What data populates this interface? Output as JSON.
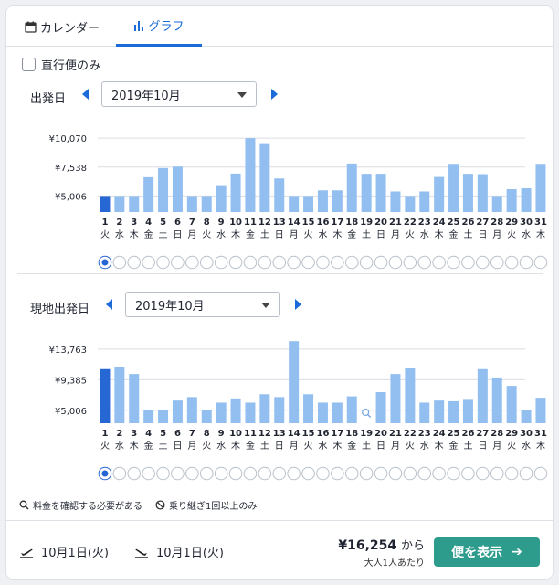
{
  "tabs": [
    {
      "label": "カレンダー",
      "icon": "calendar-icon",
      "active": false
    },
    {
      "label": "グラフ",
      "icon": "bar-chart-icon",
      "active": true
    }
  ],
  "direct_only_label": "直行便のみ",
  "departure": {
    "label": "出発日",
    "month_select": "2019年10月"
  },
  "return": {
    "label": "現地出発日",
    "month_select": "2019年10月"
  },
  "chart_data": [
    {
      "type": "bar",
      "name": "出発日",
      "categories": [
        "1",
        "2",
        "3",
        "4",
        "5",
        "6",
        "7",
        "8",
        "9",
        "10",
        "11",
        "12",
        "13",
        "14",
        "15",
        "16",
        "17",
        "18",
        "19",
        "20",
        "21",
        "22",
        "23",
        "24",
        "25",
        "26",
        "27",
        "28",
        "29",
        "30",
        "31"
      ],
      "weekdays": [
        "火",
        "水",
        "木",
        "金",
        "土",
        "日",
        "月",
        "火",
        "水",
        "木",
        "金",
        "土",
        "日",
        "月",
        "火",
        "水",
        "木",
        "金",
        "土",
        "日",
        "月",
        "火",
        "水",
        "木",
        "金",
        "土",
        "日",
        "月",
        "火",
        "水",
        "木"
      ],
      "values": [
        5006,
        5006,
        5006,
        6650,
        7450,
        7580,
        5006,
        5006,
        5950,
        6970,
        10070,
        9630,
        6540,
        5006,
        5006,
        5500,
        5500,
        7850,
        6950,
        6950,
        5400,
        5006,
        5400,
        6670,
        7820,
        6950,
        6920,
        5006,
        5600,
        5680,
        7820
      ],
      "selected_index": 0,
      "yticks": [
        "¥10,070",
        "¥7,538",
        "¥5,006"
      ],
      "ytick_values": [
        10070,
        7538,
        5006
      ],
      "ylim": [
        3600,
        10400
      ],
      "selected_color": "#2767d4",
      "bar_color": "#93bff0",
      "grid": true
    },
    {
      "type": "bar",
      "name": "現地出発日",
      "categories": [
        "1",
        "2",
        "3",
        "4",
        "5",
        "6",
        "7",
        "8",
        "9",
        "10",
        "11",
        "12",
        "13",
        "14",
        "15",
        "16",
        "17",
        "18",
        "19",
        "20",
        "21",
        "22",
        "23",
        "24",
        "25",
        "26",
        "27",
        "28",
        "29",
        "30",
        "31"
      ],
      "weekdays": [
        "火",
        "水",
        "木",
        "金",
        "土",
        "日",
        "月",
        "火",
        "水",
        "木",
        "金",
        "土",
        "日",
        "月",
        "火",
        "水",
        "木",
        "金",
        "土",
        "日",
        "月",
        "火",
        "水",
        "木",
        "金",
        "土",
        "日",
        "月",
        "火",
        "水",
        "木"
      ],
      "values": [
        10900,
        11200,
        10200,
        5006,
        5006,
        6400,
        6900,
        5006,
        6100,
        6700,
        6100,
        7300,
        6900,
        14900,
        7300,
        6100,
        6100,
        7000,
        null,
        7600,
        10200,
        11000,
        6100,
        6400,
        6300,
        6500,
        10900,
        9700,
        8500,
        5006,
        6800
      ],
      "selected_index": 0,
      "missing_index": 18,
      "yticks": [
        "¥13,763",
        "¥9,385",
        "¥5,006"
      ],
      "ytick_values": [
        13763,
        9385,
        5006
      ],
      "ylim": [
        3150,
        14400
      ],
      "selected_color": "#2767d4",
      "bar_color": "#93bff0",
      "grid": true
    }
  ],
  "legend": [
    {
      "icon": "magnifier-icon",
      "label": "料金を確認する必要がある"
    },
    {
      "icon": "prohibited-icon",
      "label": "乗り継ぎ1回以上のみ"
    }
  ],
  "footer": {
    "outbound_date": "10月1日(火)",
    "return_date": "10月1日(火)",
    "price": "¥16,254",
    "price_from": "から",
    "price_note": "大人1人あたり",
    "cta_label": "便を表示"
  }
}
